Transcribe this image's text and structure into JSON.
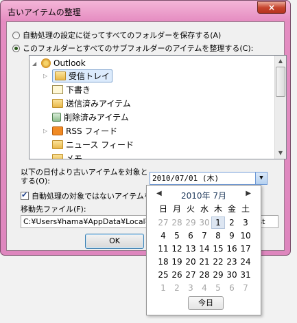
{
  "window": {
    "title": "古いアイテムの整理",
    "close_glyph": "×"
  },
  "options": {
    "radio_default": "自動処理の設定に従ってすべてのフォルダーを保存する(A)",
    "radio_this_folder": "このフォルダーとすべてのサブフォルダーのアイテムを整理する(C):"
  },
  "tree": {
    "root": "Outlook",
    "items": [
      {
        "label": "受信トレイ",
        "icon": "inbox-icon"
      },
      {
        "label": "下書き",
        "icon": "drafts-icon"
      },
      {
        "label": "送信済みアイテム",
        "icon": "sent-items-icon"
      },
      {
        "label": "削除済みアイテム",
        "icon": "deleted-items-icon"
      },
      {
        "label": "RSS フィード",
        "icon": "rss-icon"
      },
      {
        "label": "ニュース フィード",
        "icon": "folder-icon"
      },
      {
        "label": "メモ",
        "icon": "notes-icon"
      }
    ]
  },
  "date": {
    "label": "以下の日付より古いアイテムを対象とする(O):",
    "value": "2010/07/01 (木)"
  },
  "checkbox": {
    "label": "自動処理の対象ではないアイテムを対象にする",
    "checked": true
  },
  "move": {
    "label": "移動先ファイル(F):",
    "path": "C:¥Users¥hama¥AppData¥Local¥Microsoft¥Outlook¥archive.pst"
  },
  "buttons": {
    "ok": "OK"
  },
  "calendar": {
    "month_label": "2010年 7月",
    "weekdays": [
      "日",
      "月",
      "火",
      "水",
      "木",
      "金",
      "土"
    ],
    "weeks": [
      [
        "27",
        "28",
        "29",
        "30",
        "1",
        "2",
        "3"
      ],
      [
        "4",
        "5",
        "6",
        "7",
        "8",
        "9",
        "10"
      ],
      [
        "11",
        "12",
        "13",
        "14",
        "15",
        "16",
        "17"
      ],
      [
        "18",
        "19",
        "20",
        "21",
        "22",
        "23",
        "24"
      ],
      [
        "25",
        "26",
        "27",
        "28",
        "29",
        "30",
        "31"
      ],
      [
        "1",
        "2",
        "3",
        "4",
        "5",
        "6",
        "7"
      ]
    ],
    "today_button": "今日"
  }
}
